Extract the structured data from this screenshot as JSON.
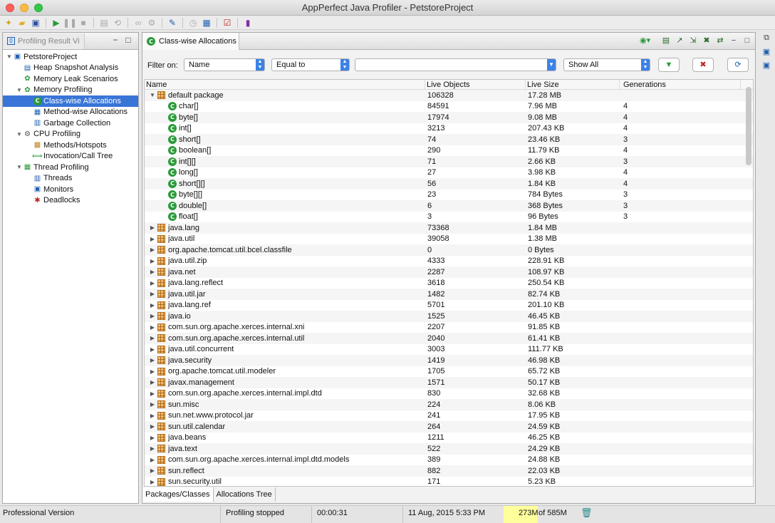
{
  "window": {
    "title": "AppPerfect Java Profiler - PetstoreProject"
  },
  "toolbar": {
    "icons": [
      "new-icon",
      "open-icon",
      "save-icon",
      "run-icon",
      "pause-icon",
      "stop-icon",
      "snapshot-icon",
      "gc-icon",
      "binoculars-icon",
      "settings-icon",
      "edit-icon",
      "clock-icon",
      "report-icon",
      "checklist-icon",
      "book-icon"
    ]
  },
  "left_panel": {
    "tab_label": "Profiling Result Vi",
    "tree": [
      {
        "label": "PetstoreProject",
        "level": 0,
        "expanded": true,
        "icon": "project-icon"
      },
      {
        "label": "Heap Snapshot Analysis",
        "level": 1,
        "icon": "heap-icon"
      },
      {
        "label": "Memory Leak Scenarios",
        "level": 1,
        "icon": "leak-icon"
      },
      {
        "label": "Memory Profiling",
        "level": 1,
        "expanded": true,
        "icon": "memory-icon"
      },
      {
        "label": "Class-wise Allocations",
        "level": 2,
        "selected": true,
        "icon": "class-icon"
      },
      {
        "label": "Method-wise Allocations",
        "level": 2,
        "icon": "method-icon"
      },
      {
        "label": "Garbage Collection",
        "level": 2,
        "icon": "gc-icon"
      },
      {
        "label": "CPU Profiling",
        "level": 1,
        "expanded": true,
        "icon": "cpu-icon"
      },
      {
        "label": "Methods/Hotspots",
        "level": 2,
        "icon": "hotspot-icon"
      },
      {
        "label": "Invocation/Call Tree",
        "level": 2,
        "icon": "calltree-icon"
      },
      {
        "label": "Thread Profiling",
        "level": 1,
        "expanded": true,
        "icon": "thread-icon"
      },
      {
        "label": "Threads",
        "level": 2,
        "icon": "threads-icon"
      },
      {
        "label": "Monitors",
        "level": 2,
        "icon": "monitor-icon"
      },
      {
        "label": "Deadlocks",
        "level": 2,
        "icon": "deadlock-icon"
      }
    ]
  },
  "main": {
    "tab_label": "Class-wise Allocations",
    "filter": {
      "label": "Filter on:",
      "field": "Name",
      "operator": "Equal to",
      "value": "",
      "show": "Show All"
    },
    "columns": [
      "Name",
      "Live Objects",
      "Live Size",
      "Generations"
    ],
    "rows": [
      {
        "name": "default package",
        "type": "package",
        "expanded": true,
        "live": "106328",
        "size": "17.28 MB",
        "gen": ""
      },
      {
        "name": "char[]",
        "type": "class",
        "live": "84591",
        "size": "7.96 MB",
        "gen": "4"
      },
      {
        "name": "byte[]",
        "type": "class",
        "live": "17974",
        "size": "9.08 MB",
        "gen": "4"
      },
      {
        "name": "int[]",
        "type": "class",
        "live": "3213",
        "size": "207.43 KB",
        "gen": "4"
      },
      {
        "name": "short[]",
        "type": "class",
        "live": "74",
        "size": "23.46 KB",
        "gen": "3"
      },
      {
        "name": "boolean[]",
        "type": "class",
        "live": "290",
        "size": "11.79 KB",
        "gen": "4"
      },
      {
        "name": "int[][]",
        "type": "class",
        "live": "71",
        "size": "2.66 KB",
        "gen": "3"
      },
      {
        "name": "long[]",
        "type": "class",
        "live": "27",
        "size": "3.98 KB",
        "gen": "4"
      },
      {
        "name": "short[][]",
        "type": "class",
        "live": "56",
        "size": "1.84 KB",
        "gen": "4"
      },
      {
        "name": "byte[][]",
        "type": "class",
        "live": "23",
        "size": "784 Bytes",
        "gen": "3"
      },
      {
        "name": "double[]",
        "type": "class",
        "live": "6",
        "size": "368 Bytes",
        "gen": "3"
      },
      {
        "name": "float[]",
        "type": "class",
        "live": "3",
        "size": "96 Bytes",
        "gen": "3"
      },
      {
        "name": "java.lang",
        "type": "package",
        "live": "73368",
        "size": "1.84 MB",
        "gen": ""
      },
      {
        "name": "java.util",
        "type": "package",
        "live": "39058",
        "size": "1.38 MB",
        "gen": ""
      },
      {
        "name": "org.apache.tomcat.util.bcel.classfile",
        "type": "package",
        "live": "0",
        "size": "0 Bytes",
        "gen": ""
      },
      {
        "name": "java.util.zip",
        "type": "package",
        "live": "4333",
        "size": "228.91 KB",
        "gen": ""
      },
      {
        "name": "java.net",
        "type": "package",
        "live": "2287",
        "size": "108.97 KB",
        "gen": ""
      },
      {
        "name": "java.lang.reflect",
        "type": "package",
        "live": "3618",
        "size": "250.54 KB",
        "gen": ""
      },
      {
        "name": "java.util.jar",
        "type": "package",
        "live": "1482",
        "size": "82.74 KB",
        "gen": ""
      },
      {
        "name": "java.lang.ref",
        "type": "package",
        "live": "5701",
        "size": "201.10 KB",
        "gen": ""
      },
      {
        "name": "java.io",
        "type": "package",
        "live": "1525",
        "size": "46.45 KB",
        "gen": ""
      },
      {
        "name": "com.sun.org.apache.xerces.internal.xni",
        "type": "package",
        "live": "2207",
        "size": "91.85 KB",
        "gen": ""
      },
      {
        "name": "com.sun.org.apache.xerces.internal.util",
        "type": "package",
        "live": "2040",
        "size": "61.41 KB",
        "gen": ""
      },
      {
        "name": "java.util.concurrent",
        "type": "package",
        "live": "3003",
        "size": "111.77 KB",
        "gen": ""
      },
      {
        "name": "java.security",
        "type": "package",
        "live": "1419",
        "size": "46.98 KB",
        "gen": ""
      },
      {
        "name": "org.apache.tomcat.util.modeler",
        "type": "package",
        "live": "1705",
        "size": "65.72 KB",
        "gen": ""
      },
      {
        "name": "javax.management",
        "type": "package",
        "live": "1571",
        "size": "50.17 KB",
        "gen": ""
      },
      {
        "name": "com.sun.org.apache.xerces.internal.impl.dtd",
        "type": "package",
        "live": "830",
        "size": "32.68 KB",
        "gen": ""
      },
      {
        "name": "sun.misc",
        "type": "package",
        "live": "224",
        "size": "8.06 KB",
        "gen": ""
      },
      {
        "name": "sun.net.www.protocol.jar",
        "type": "package",
        "live": "241",
        "size": "17.95 KB",
        "gen": ""
      },
      {
        "name": "sun.util.calendar",
        "type": "package",
        "live": "264",
        "size": "24.59 KB",
        "gen": ""
      },
      {
        "name": "java.beans",
        "type": "package",
        "live": "1211",
        "size": "46.25 KB",
        "gen": ""
      },
      {
        "name": "java.text",
        "type": "package",
        "live": "522",
        "size": "24.29 KB",
        "gen": ""
      },
      {
        "name": "com.sun.org.apache.xerces.internal.impl.dtd.models",
        "type": "package",
        "live": "389",
        "size": "24.88 KB",
        "gen": ""
      },
      {
        "name": "sun.reflect",
        "type": "package",
        "live": "882",
        "size": "22.03 KB",
        "gen": ""
      },
      {
        "name": "sun.security.util",
        "type": "package",
        "live": "171",
        "size": "5.23 KB",
        "gen": ""
      }
    ],
    "bottom_tabs": [
      "Packages/Classes",
      "Allocations Tree"
    ]
  },
  "status": {
    "edition": "Professional Version",
    "state": "Profiling stopped",
    "elapsed": "00:00:31",
    "datetime": "11 Aug, 2015 5:33 PM",
    "mem_used": "273M",
    "mem_total": "of 585M"
  }
}
